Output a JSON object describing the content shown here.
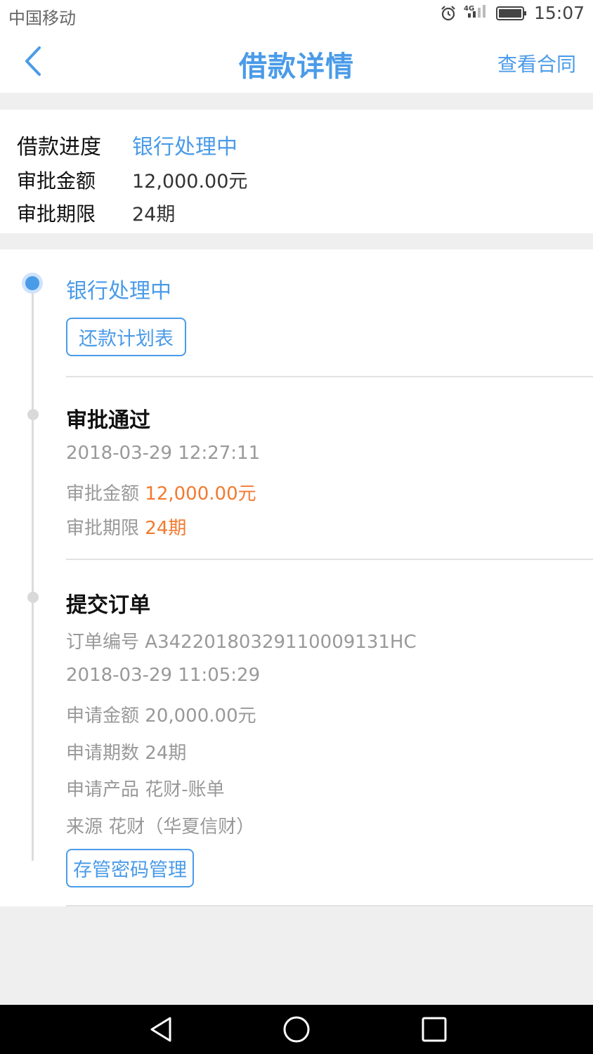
{
  "status_bar": {
    "carrier": "中国移动",
    "network": "4G",
    "time": "15:07"
  },
  "header": {
    "title": "借款详情",
    "contract_link": "查看合同"
  },
  "summary": {
    "progress_label": "借款进度",
    "progress_value": "银行处理中",
    "amount_label": "审批金额",
    "amount_value": "12,000.00元",
    "term_label": "审批期限",
    "term_value": "24期"
  },
  "timeline": {
    "current": {
      "title": "银行处理中",
      "button": "还款计划表"
    },
    "approved": {
      "title": "审批通过",
      "time": "2018-03-29 12:27:11",
      "amount_label": "审批金额",
      "amount_value": "12,000.00元",
      "term_label": "审批期限",
      "term_value": "24期"
    },
    "submitted": {
      "title": "提交订单",
      "order_label": "订单编号",
      "order_value": "A34220180329110009131HC",
      "time": "2018-03-29 11:05:29",
      "apply_amount_label": "申请金额",
      "apply_amount_value": "20,000.00元",
      "apply_term_label": "申请期数",
      "apply_term_value": "24期",
      "product_label": "申请产品",
      "product_value": "花财-账单",
      "source_label": "来源",
      "source_value": "花财（华夏信财）",
      "button": "存管密码管理"
    }
  },
  "colors": {
    "accent": "#4a9be8",
    "highlight": "#f27a2e"
  }
}
